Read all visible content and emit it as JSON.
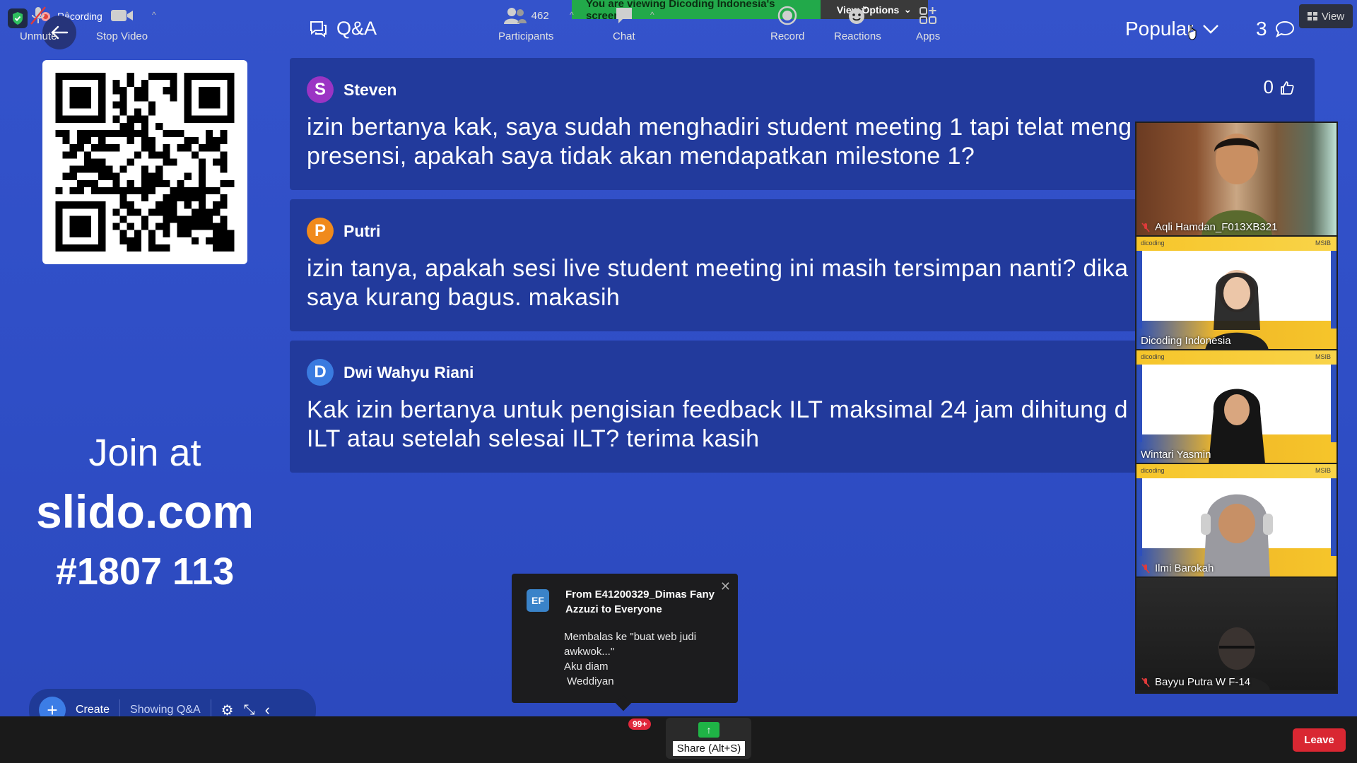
{
  "status": {
    "recording_label": "Recording"
  },
  "share_banner": {
    "message": "You are viewing Dicoding Indonesia's screen",
    "options_label": "View Options"
  },
  "view_button": {
    "label": "View"
  },
  "qa_panel": {
    "title": "Q&A",
    "sort_label": "Popular",
    "question_count": "3"
  },
  "join": {
    "prefix": "Join at",
    "url": "slido.com",
    "code": "#1807 113"
  },
  "questions": [
    {
      "initial": "S",
      "author": "Steven",
      "avatar_color": "#9b34c4",
      "likes": "0",
      "line1": "izin bertanya kak, saya sudah menghadiri student meeting 1 tapi telat meng",
      "line2": "presensi, apakah saya tidak akan mendapatkan milestone 1?"
    },
    {
      "initial": "P",
      "author": "Putri",
      "avatar_color": "#f08a1c",
      "likes": "",
      "line1": "izin tanya, apakah sesi live student meeting ini masih tersimpan nanti? dika",
      "line2": "saya kurang bagus. makasih"
    },
    {
      "initial": "D",
      "author": "Dwi Wahyu Riani",
      "avatar_color": "#3a7be0",
      "likes": "",
      "line1": "Kak izin bertanya untuk pengisian feedback ILT maksimal 24 jam dihitung d",
      "line2": "ILT atau setelah selesai ILT? terima kasih"
    }
  ],
  "participants_strip": [
    {
      "name": "Aqli Hamdan_F013XB321",
      "muted": true,
      "background": "room"
    },
    {
      "name": "Dicoding Indonesia",
      "muted": false,
      "background": "brand"
    },
    {
      "name": "Wintari Yasmin",
      "muted": false,
      "background": "brand"
    },
    {
      "name": "Ilmi Barokah",
      "muted": true,
      "background": "brand"
    },
    {
      "name": "Bayyu Putra W F-14",
      "muted": true,
      "background": "dark"
    }
  ],
  "brand_tile": {
    "left_text": "dicoding",
    "right_text": "MSIB"
  },
  "chat_notification": {
    "initials": "EF",
    "from": "From E41200329_Dimas Fany Azzuzi to Everyone",
    "line1": "Membalas ke \"buat web judi",
    "line2": "awkwok...\"",
    "line3": "Aku diam",
    "line4": " Weddiyan"
  },
  "slido_controls": {
    "create_label": "Create",
    "mode_label": "Showing Q&A"
  },
  "toolbar": {
    "unmute": "Unmute",
    "stop_video": "Stop Video",
    "participants": "Participants",
    "participant_count": "462",
    "chat": "Chat",
    "chat_unread": "99+",
    "share": "Share (Alt+S)",
    "record": "Record",
    "reactions": "Reactions",
    "apps": "Apps",
    "leave": "Leave"
  },
  "colors": {
    "background": "#2f4fc8",
    "question_card": "#223a9c",
    "banner_green": "#22a94a",
    "leave_red": "#d92732"
  }
}
